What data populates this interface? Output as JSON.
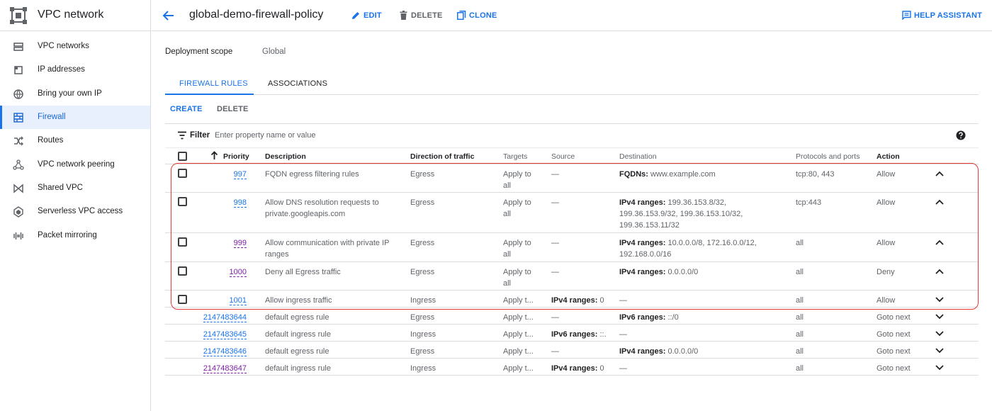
{
  "sidebar": {
    "title": "VPC network",
    "items": [
      {
        "label": "VPC networks",
        "icon": "vpc-networks-icon"
      },
      {
        "label": "IP addresses",
        "icon": "ip-addresses-icon"
      },
      {
        "label": "Bring your own IP",
        "icon": "globe-icon"
      },
      {
        "label": "Firewall",
        "icon": "firewall-icon",
        "active": true
      },
      {
        "label": "Routes",
        "icon": "routes-icon"
      },
      {
        "label": "VPC network peering",
        "icon": "peering-icon"
      },
      {
        "label": "Shared VPC",
        "icon": "shared-vpc-icon"
      },
      {
        "label": "Serverless VPC access",
        "icon": "serverless-icon"
      },
      {
        "label": "Packet mirroring",
        "icon": "packet-mirroring-icon"
      }
    ]
  },
  "header": {
    "title": "global-demo-firewall-policy",
    "edit": "EDIT",
    "delete": "DELETE",
    "clone": "CLONE",
    "help": "HELP ASSISTANT"
  },
  "details": {
    "scope_label": "Deployment scope",
    "scope_value": "Global"
  },
  "tabs": [
    "FIREWALL RULES",
    "ASSOCIATIONS"
  ],
  "actions": {
    "create": "CREATE",
    "delete": "DELETE"
  },
  "filter": {
    "label": "Filter",
    "placeholder": "Enter property name or value"
  },
  "table": {
    "columns": [
      "Priority",
      "Description",
      "Direction of traffic",
      "Targets",
      "Source",
      "Destination",
      "Protocols and ports",
      "Action"
    ],
    "rows": [
      {
        "priority": "997",
        "description": [
          "FQDN egress filtering rules"
        ],
        "direction": "Egress",
        "targets": [
          "Apply to",
          "all"
        ],
        "source_label": "",
        "source": "—",
        "dest_label": "FQDNs:",
        "destination": [
          " www.example.com"
        ],
        "protocols": "tcp:80, 443",
        "action": "Allow",
        "expanded": true
      },
      {
        "priority": "998",
        "description": [
          "Allow DNS resolution requests to",
          "private.googleapis.com"
        ],
        "direction": "Egress",
        "targets": [
          "Apply to",
          "all"
        ],
        "source_label": "",
        "source": "—",
        "dest_label": "IPv4 ranges:",
        "destination": [
          " 199.36.153.8/32,",
          "199.36.153.9/32, 199.36.153.10/32,",
          "199.36.153.11/32"
        ],
        "protocols": "tcp:443",
        "action": "Allow",
        "expanded": true
      },
      {
        "priority": "999",
        "description": [
          "Allow communication with private IP",
          "ranges"
        ],
        "direction": "Egress",
        "targets": [
          "Apply to",
          "all"
        ],
        "source_label": "",
        "source": "—",
        "dest_label": "IPv4 ranges:",
        "destination": [
          " 10.0.0.0/8, 172.16.0.0/12,",
          "192.168.0.0/16"
        ],
        "protocols": "all",
        "action": "Allow",
        "expanded": true
      },
      {
        "priority": "1000",
        "description": [
          "Deny all Egress traffic"
        ],
        "direction": "Egress",
        "targets": [
          "Apply to",
          "all"
        ],
        "source_label": "",
        "source": "—",
        "dest_label": "IPv4 ranges:",
        "destination": [
          " 0.0.0.0/0"
        ],
        "protocols": "all",
        "action": "Deny",
        "expanded": true
      },
      {
        "priority": "1001",
        "description": [
          "Allow ingress traffic"
        ],
        "direction": "Ingress",
        "targets": [
          "Apply t..."
        ],
        "source_label": "IPv4 ranges:",
        "source": " 0",
        "dest_label": "",
        "destination": [
          "—"
        ],
        "protocols": "all",
        "action": "Allow",
        "expanded": false
      },
      {
        "priority": "2147483644",
        "description": [
          "default egress rule"
        ],
        "direction": "Egress",
        "targets": [
          "Apply t..."
        ],
        "source_label": "",
        "source": "—",
        "dest_label": "IPv6 ranges:",
        "destination": [
          " ::/0"
        ],
        "protocols": "all",
        "action": "Goto next",
        "expanded": false
      },
      {
        "priority": "2147483645",
        "description": [
          "default ingress rule"
        ],
        "direction": "Ingress",
        "targets": [
          "Apply t..."
        ],
        "source_label": "IPv6 ranges:",
        "source": " ::.",
        "dest_label": "",
        "destination": [
          "—"
        ],
        "protocols": "all",
        "action": "Goto next",
        "expanded": false
      },
      {
        "priority": "2147483646",
        "description": [
          "default egress rule"
        ],
        "direction": "Egress",
        "targets": [
          "Apply t..."
        ],
        "source_label": "",
        "source": "—",
        "dest_label": "IPv4 ranges:",
        "destination": [
          " 0.0.0.0/0"
        ],
        "protocols": "all",
        "action": "Goto next",
        "expanded": false
      },
      {
        "priority": "2147483647",
        "description": [
          "default ingress rule"
        ],
        "direction": "Ingress",
        "targets": [
          "Apply t..."
        ],
        "source_label": "IPv4 ranges:",
        "source": " 0",
        "dest_label": "",
        "destination": [
          "—"
        ],
        "protocols": "all",
        "action": "Goto next",
        "expanded": false
      }
    ]
  },
  "colors": {
    "accent": "#1a73e8",
    "visited_link": "#7b1fa2",
    "highlight": "#e53935",
    "active_nav_bg": "#e8f0fe"
  }
}
